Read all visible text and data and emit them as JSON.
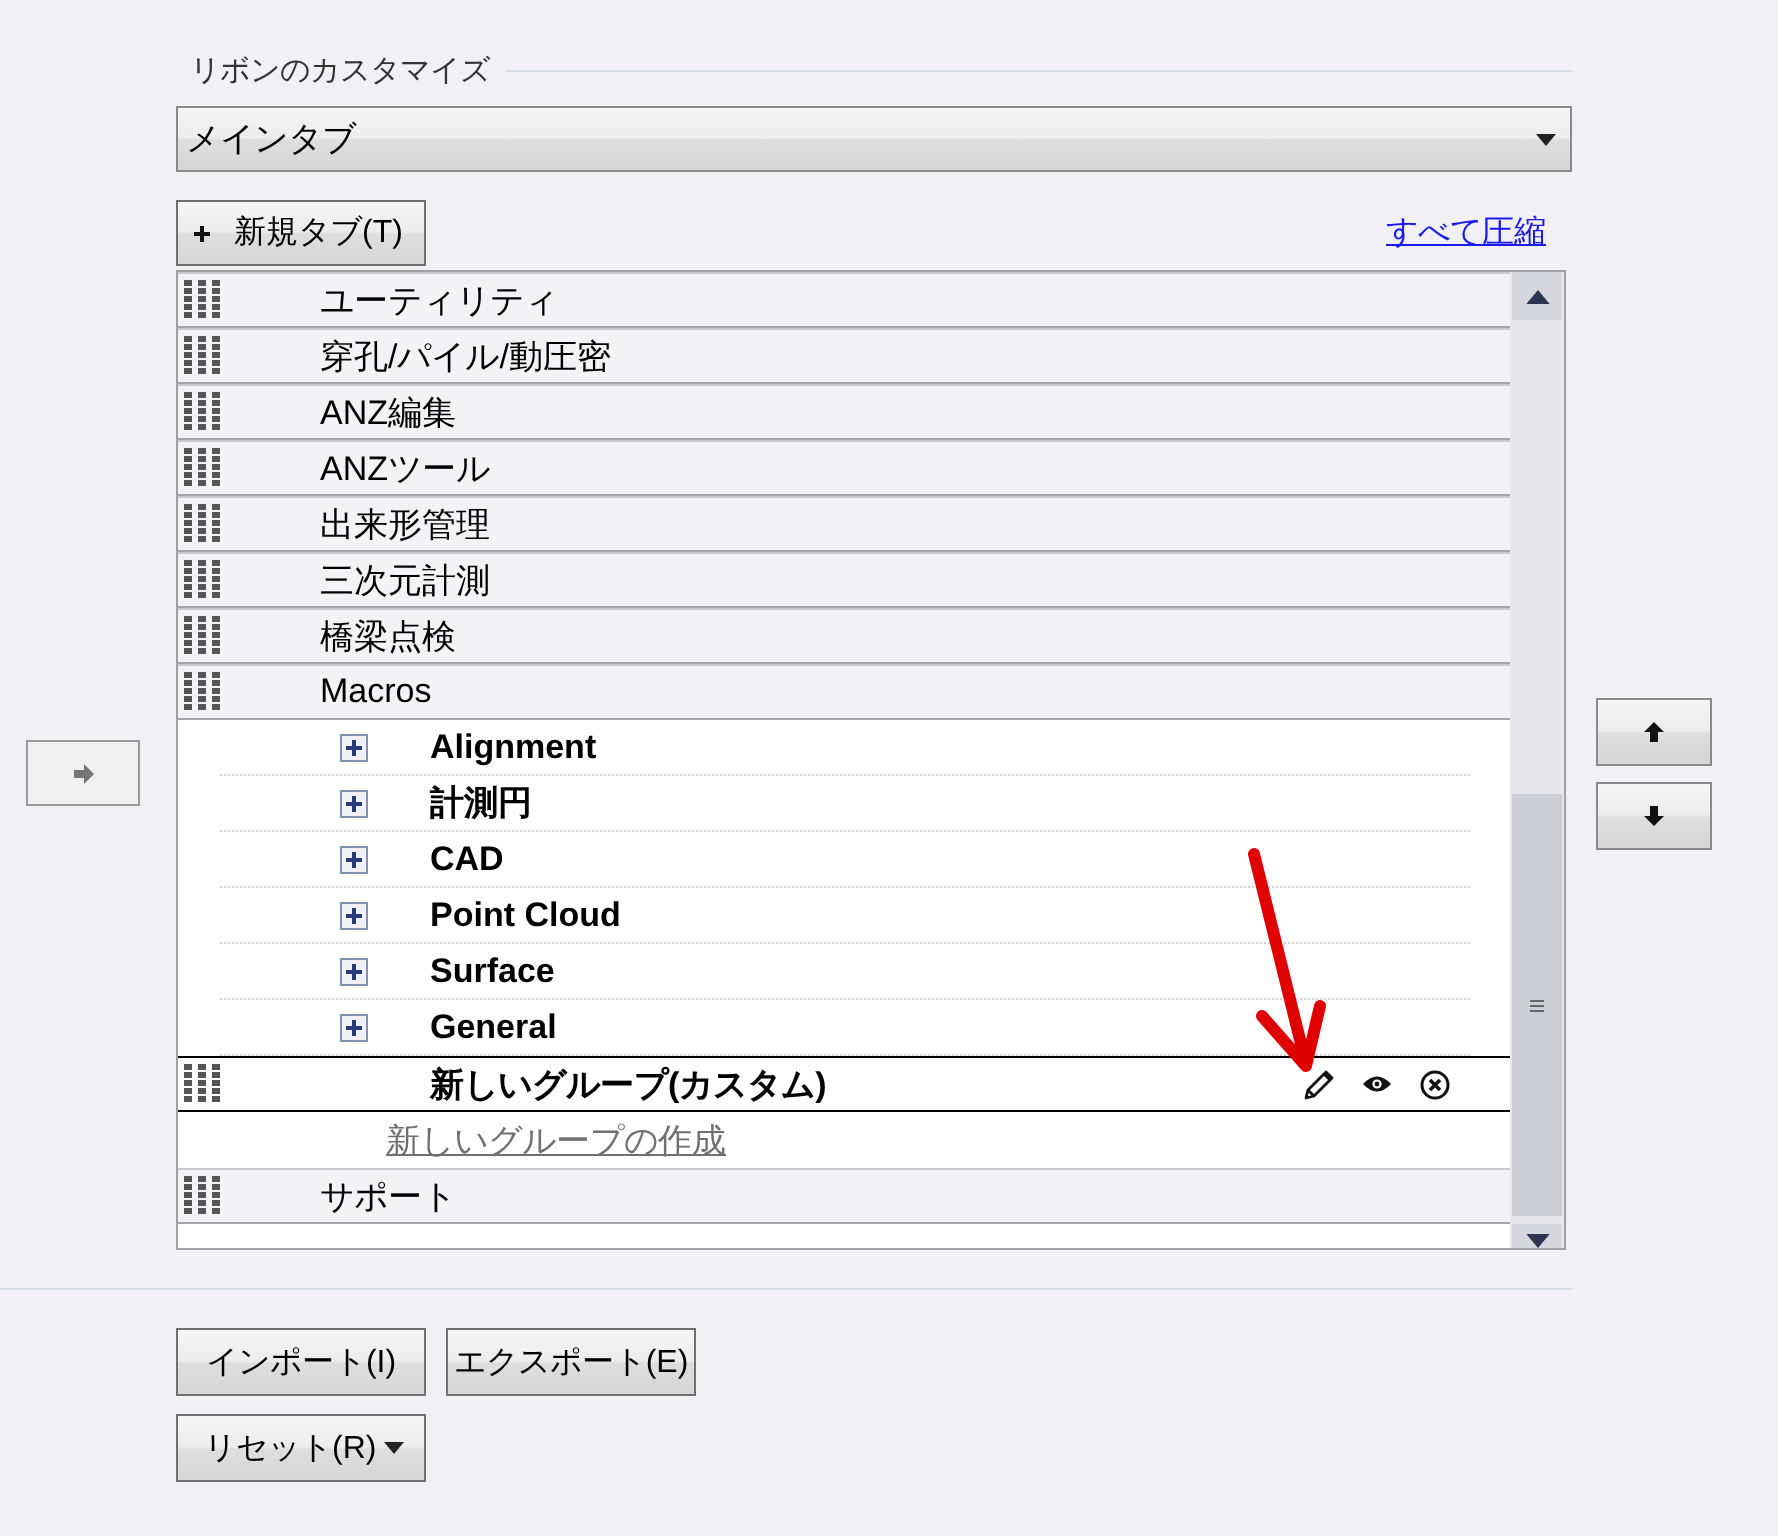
{
  "section_title": "リボンのカスタマイズ",
  "tab_selector": {
    "value": "メインタブ"
  },
  "new_tab_button": {
    "label": "新規タブ(T)"
  },
  "collapse_all_link": "すべて圧縮",
  "tabs": [
    {
      "label": "ユーティリティ",
      "selected": false
    },
    {
      "label": "穿孔/パイル/動圧密",
      "selected": false
    },
    {
      "label": "ANZ編集",
      "selected": false
    },
    {
      "label": "ANZツール",
      "selected": false
    },
    {
      "label": "出来形管理",
      "selected": false
    },
    {
      "label": "三次元計測",
      "selected": false
    },
    {
      "label": "橋梁点検",
      "selected": false
    },
    {
      "label": "Macros",
      "selected": false,
      "children": [
        {
          "kind": "group",
          "label": "Alignment",
          "expanded": false,
          "selected": false
        },
        {
          "kind": "group",
          "label": "計測円",
          "expanded": false,
          "selected": false
        },
        {
          "kind": "group",
          "label": "CAD",
          "expanded": false,
          "selected": false
        },
        {
          "kind": "group",
          "label": "Point Cloud",
          "expanded": false,
          "selected": false
        },
        {
          "kind": "group",
          "label": "Surface",
          "expanded": false,
          "selected": false
        },
        {
          "kind": "group",
          "label": "General",
          "expanded": false,
          "selected": false
        },
        {
          "kind": "custom_group",
          "label": "新しいグループ(カスタム)",
          "selected": true
        }
      ],
      "add_group_link": "新しいグループの作成"
    },
    {
      "label": "サポート",
      "selected": false
    }
  ],
  "buttons": [
    {
      "kind": "plain",
      "label": "インポート(I)"
    },
    {
      "kind": "plain",
      "label": "エクスポート(E)"
    },
    {
      "kind": "menu",
      "label": "リセット(R)"
    }
  ]
}
